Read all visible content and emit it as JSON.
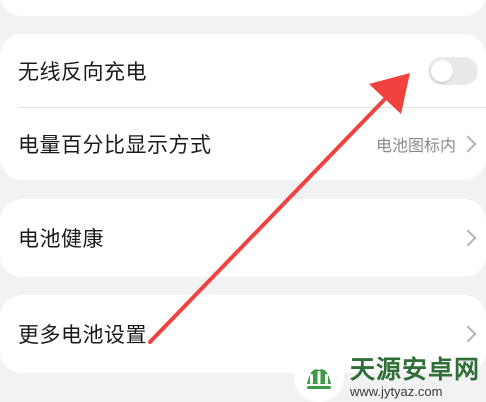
{
  "settings": {
    "wireless_reverse_charging": {
      "label": "无线反向充电",
      "enabled": false
    },
    "battery_percentage_display": {
      "label": "电量百分比显示方式",
      "value": "电池图标内"
    },
    "battery_health": {
      "label": "电池健康"
    },
    "more_battery_settings": {
      "label": "更多电池设置"
    }
  },
  "annotation": {
    "arrow_color": "#f0423f"
  },
  "watermark": {
    "brand": "天源安卓网",
    "url": "www.jytyaz.com"
  }
}
